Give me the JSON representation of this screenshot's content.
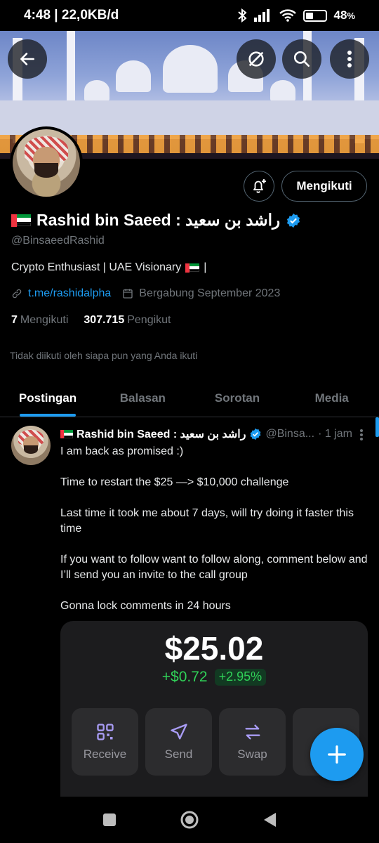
{
  "status_bar": {
    "time_speed": "4:48 | 22,0KB/d",
    "battery": "48",
    "battery_unit": "%",
    "battery_level": 0.48
  },
  "header": {
    "icons": [
      "back-arrow-icon",
      "eye-off-icon",
      "search-icon",
      "more-vertical-icon"
    ]
  },
  "profile": {
    "name": "Rashid bin Saeed : راشد بن سعيد",
    "handle": "@BinsaeedRashid",
    "bio": "Crypto Enthusiast | UAE Visionary",
    "bio_suffix": "|",
    "link": "t.me/rashidalpha",
    "joined": "Bergabung September 2023",
    "following_count": "7",
    "following_label": "Mengikuti",
    "followers_count": "307.715",
    "followers_label": "Pengikut",
    "not_followed_note": "Tidak diikuti oleh siapa pun yang Anda ikuti",
    "follow_button": "Mengikuti"
  },
  "tabs": [
    "Postingan",
    "Balasan",
    "Sorotan",
    "Media"
  ],
  "post": {
    "name": "Rashid bin Saeed : راشد بن سعيد",
    "handle": "@Binsa...",
    "time": "· 1 jam",
    "lines": [
      "I am back as promised :)",
      "Time to restart the $25 —> $10,000 challenge",
      "Last time it took me about 7 days, will try doing it faster this time",
      "If you want to follow want to follow along, comment below and I’ll send you an invite to the call group",
      "Gonna lock comments in 24 hours"
    ],
    "wallet": {
      "balance": "$25.02",
      "change": "+$0.72",
      "change_pct": "+2.95%",
      "actions": [
        "Receive",
        "Send",
        "Swap"
      ]
    }
  },
  "colors": {
    "accent": "#1d9bf0",
    "positive": "#30d158",
    "background": "#000000"
  }
}
